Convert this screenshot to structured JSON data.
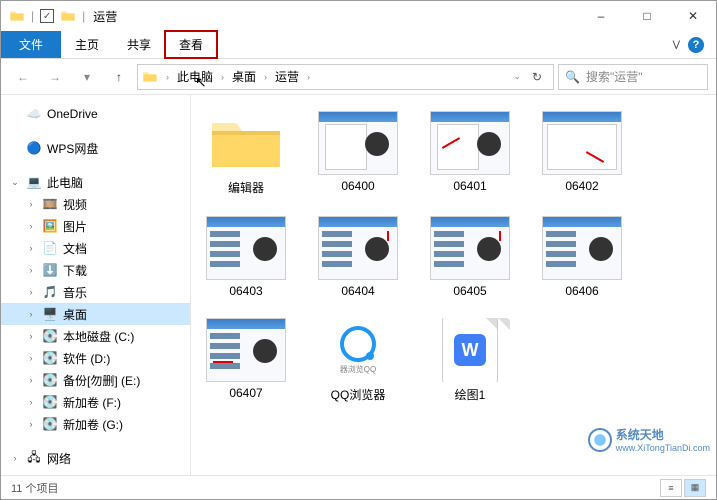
{
  "window": {
    "title": "运营",
    "minimize": "–",
    "maximize": "□",
    "close": "✕"
  },
  "tabs": {
    "file": "文件",
    "home": "主页",
    "share": "共享",
    "view": "查看"
  },
  "nav": {
    "back": "←",
    "forward": "→",
    "recent": "▾",
    "up": "↑"
  },
  "breadcrumb": {
    "root": "此电脑",
    "seg1": "桌面",
    "seg2": "运营"
  },
  "search": {
    "placeholder": "搜索\"运营\""
  },
  "sidebar": {
    "onedrive": "OneDrive",
    "wps": "WPS网盘",
    "thispc": "此电脑",
    "videos": "视频",
    "pictures": "图片",
    "documents": "文档",
    "downloads": "下载",
    "music": "音乐",
    "desktop": "桌面",
    "localc": "本地磁盘 (C:)",
    "disk_d": "软件 (D:)",
    "disk_e": "备份[勿删] (E:)",
    "disk_f": "新加卷 (F:)",
    "disk_g": "新加卷 (G:)",
    "network": "网络"
  },
  "items": {
    "folder1": "编辑器",
    "file1": "06400",
    "file2": "06401",
    "file3": "06402",
    "file4": "06403",
    "file5": "06404",
    "file6": "06405",
    "file7": "06406",
    "file8": "06407",
    "app1": "QQ浏览器",
    "doc1": "绘图1"
  },
  "status": {
    "count": "11 个项目"
  },
  "watermark": {
    "brand": "系统天地",
    "url": "www.XiTongTianDi.com"
  }
}
